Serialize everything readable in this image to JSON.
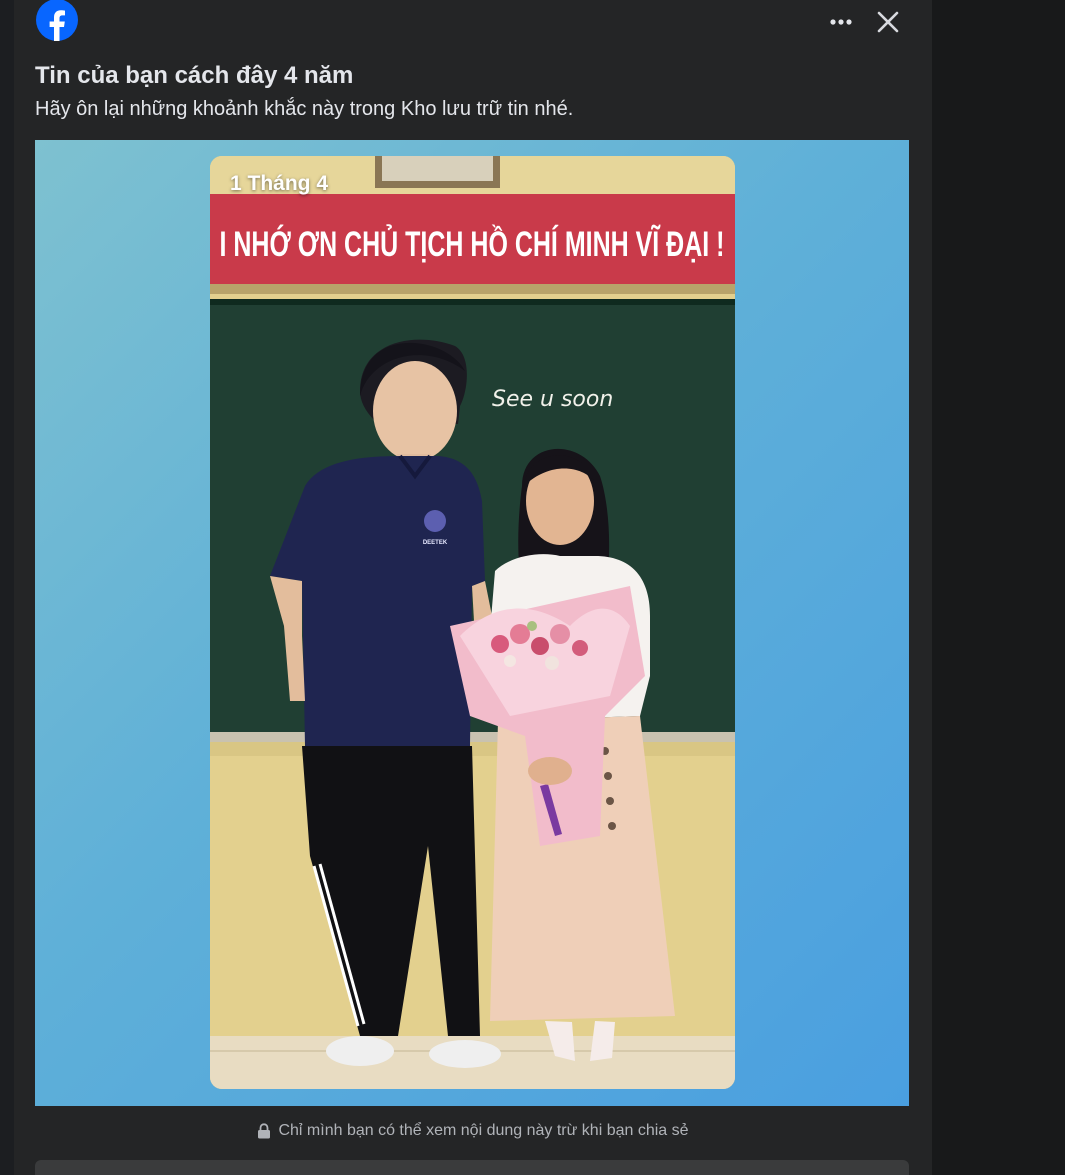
{
  "dialog": {
    "title": "Tin của bạn cách đây 4 năm",
    "subtitle": "Hãy ôn lại những khoảnh khắc này trong Kho lưu trữ tin nhé."
  },
  "header_icons": {
    "logo": "facebook-logo",
    "more": "more-options-icon",
    "close": "close-icon"
  },
  "story": {
    "date_label": "1 Tháng 4",
    "banner_text": "I NHỚ ƠN CHỦ TỊCH HỒ CHÍ MINH VĨ ĐẠI !",
    "board_text": "See u soon",
    "shirt_logo_text": "DEETEK"
  },
  "privacy": {
    "icon": "lock-icon",
    "text": "Chỉ mình bạn có thể xem nội dung này trừ khi bạn chia sẻ"
  },
  "colors": {
    "card_bg": "#242526",
    "page_bg": "#18191a",
    "brand_blue": "#0866ff",
    "text_primary": "#e4e6eb",
    "text_secondary": "#b0b3b8"
  }
}
